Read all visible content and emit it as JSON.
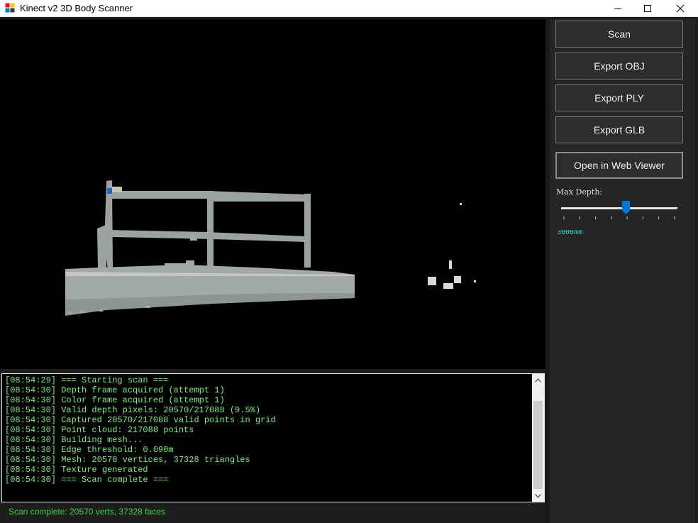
{
  "window": {
    "title": "Kinect v2 3D Body Scanner",
    "icon": "winforms-app-icon",
    "controls": [
      "minimize-icon",
      "maximize-icon",
      "close-icon"
    ]
  },
  "viewport": {
    "content": "depth-point-cloud-preview",
    "background": "#000000"
  },
  "log": {
    "lines": [
      "[08:54:29] === Starting scan ===",
      "[08:54:30] Depth frame acquired (attempt 1)",
      "[08:54:30] Color frame acquired (attempt 1)",
      "[08:54:30] Valid depth pixels: 20570/217088 (9.5%)",
      "[08:54:30] Captured 20570/217088 valid points in grid",
      "[08:54:30] Point cloud: 217088 points",
      "[08:54:30] Building mesh...",
      "[08:54:30] Edge threshold: 0.090m",
      "[08:54:30] Mesh: 20570 vertices, 37328 triangles",
      "[08:54:30] Texture generated",
      "[08:54:30] === Scan complete ==="
    ],
    "text_color": "#7cf07c"
  },
  "status": {
    "text": "Scan complete: 20570 verts, 37328 faces",
    "color": "#3fd13f"
  },
  "panel": {
    "buttons": {
      "scan": "Scan",
      "export_obj": "Export OBJ",
      "export_ply": "Export PLY",
      "export_glb": "Export GLB",
      "open_web_viewer": "Open in Web Viewer"
    },
    "max_depth": {
      "label": "Max Depth:",
      "value_text": "3000mm",
      "slider_fraction": 0.56,
      "tick_count": 8,
      "accent": "#0078d7"
    }
  }
}
